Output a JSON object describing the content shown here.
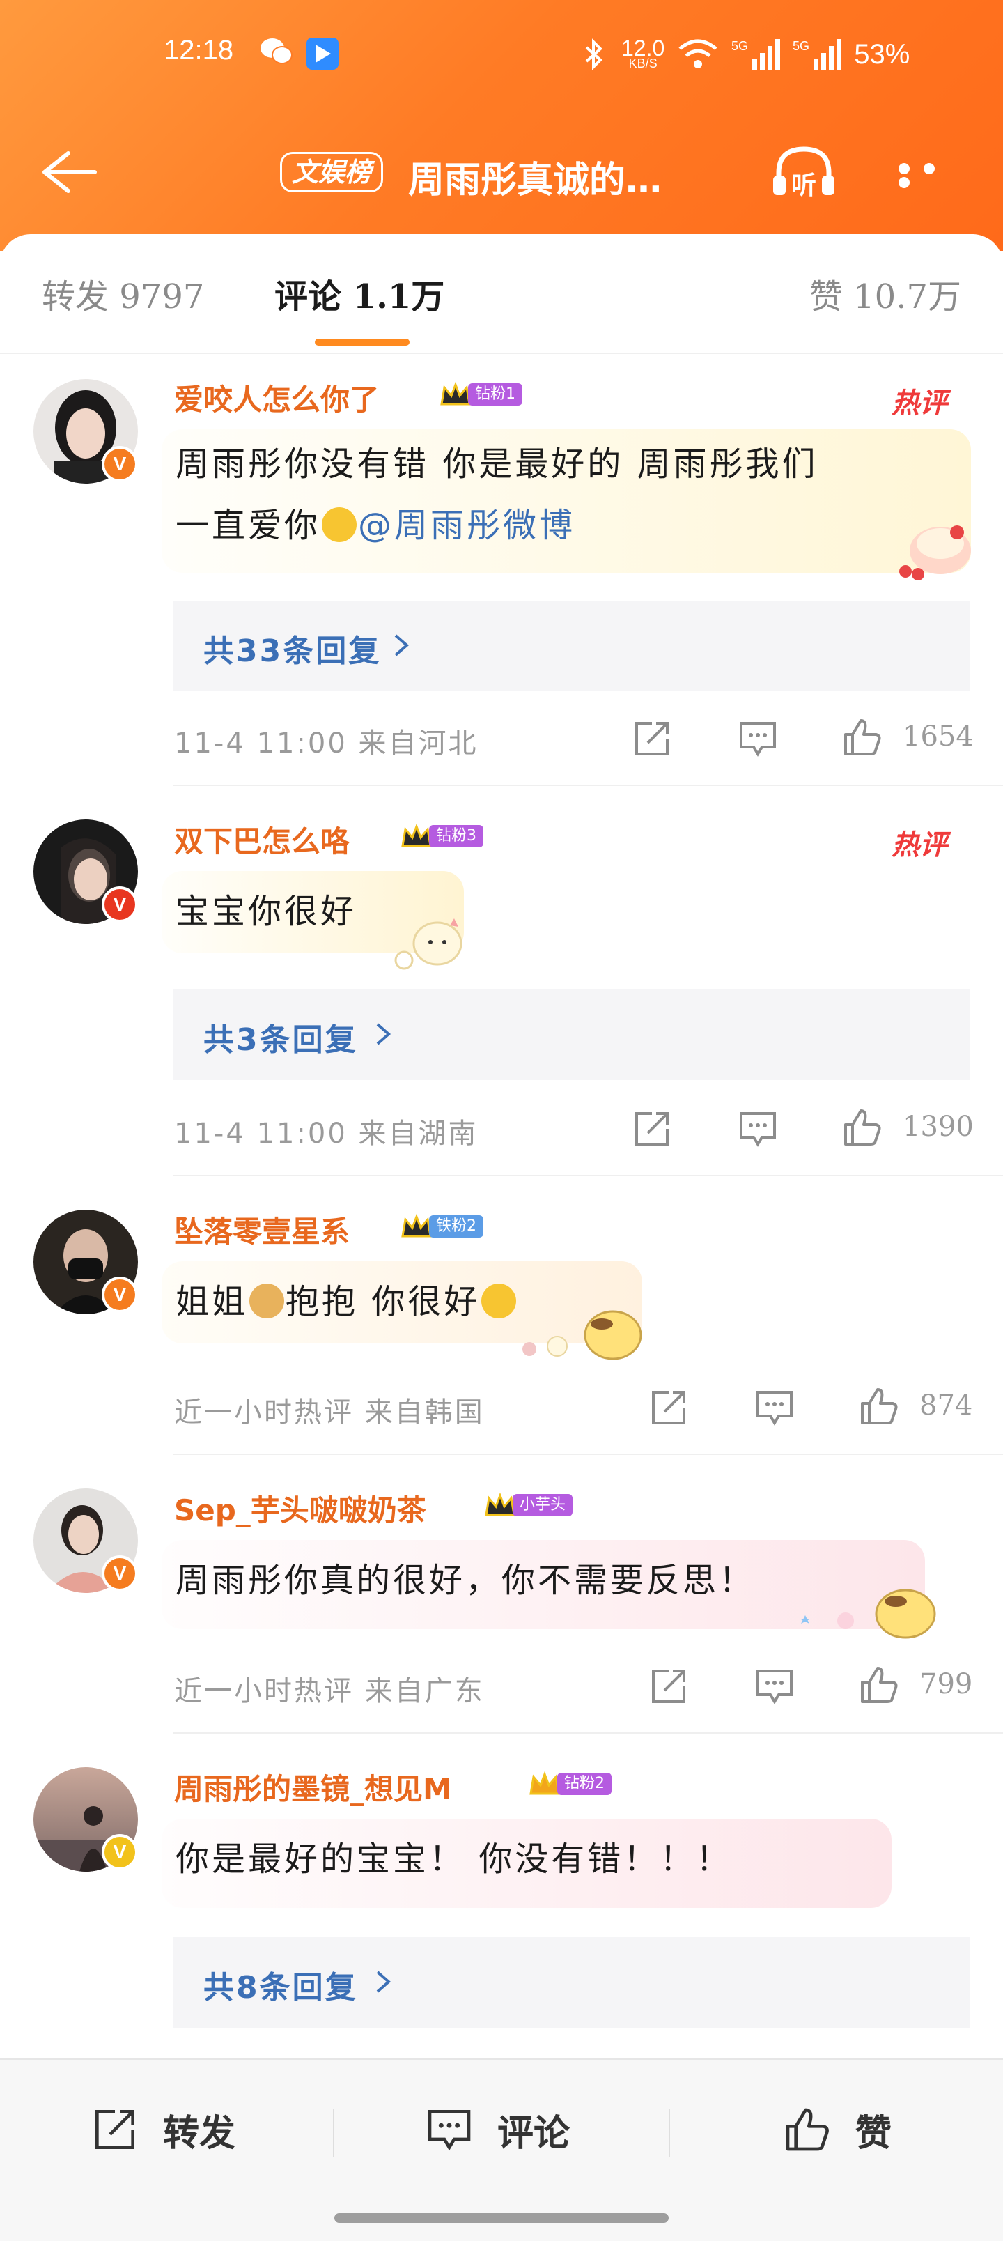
{
  "status": {
    "time": "12:18",
    "speed_value": "12.0",
    "speed_unit": "KB/S",
    "net1": "5G",
    "net2": "5G",
    "battery": "53%"
  },
  "nav": {
    "tag": "文娱榜",
    "title": "周雨彤真诚的…",
    "listen_label": "听"
  },
  "tabs": {
    "forward": {
      "label": "转发",
      "count": "9797"
    },
    "comment": {
      "label": "评论",
      "count": "1.1万"
    },
    "like": {
      "label": "赞",
      "count": "10.7万"
    }
  },
  "colors": {
    "accent": "#ff8a1f",
    "username": "#e8681e",
    "link": "#3b6fb6",
    "hot": "#ef3a3a"
  },
  "comments": [
    {
      "username": "爱咬人怎么你了",
      "fan_level": "钻粉1",
      "hot_tag": "热评",
      "line1": "周雨彤你没有错 你是最好的 周雨彤我们",
      "line2_pre": "一直爱你",
      "emoji": "crying-face",
      "mention": "@周雨彤微博",
      "replies": "共33条回复",
      "time": "11-4 11:00",
      "location": "来自河北",
      "likes": "1654"
    },
    {
      "username": "双下巴怎么咯",
      "fan_level": "钻粉3",
      "hot_tag": "热评",
      "text": "宝宝你很好",
      "replies": "共3条回复",
      "time": "11-4 11:00",
      "location": "来自湖南",
      "likes": "1390"
    },
    {
      "username": "坠落零壹星系",
      "fan_level": "铁粉2",
      "text_a": "姐姐",
      "text_b": "抱抱 你很好",
      "emoji_a": "doge",
      "emoji_b": "hug",
      "time": "近一小时热评",
      "location": "来自韩国",
      "likes": "874"
    },
    {
      "username": "Sep_芋头啵啵奶茶",
      "fan_level": "小芋头",
      "text": "周雨彤你真的很好，你不需要反思！",
      "time": "近一小时热评",
      "location": "来自广东",
      "likes": "799"
    },
    {
      "username": "周雨彤的墨镜_想见M",
      "fan_level": "钻粉2",
      "text": "你是最好的宝宝！ 你没有错！！！",
      "replies": "共8条回复"
    }
  ],
  "bottom": {
    "forward": "转发",
    "comment": "评论",
    "like": "赞"
  }
}
